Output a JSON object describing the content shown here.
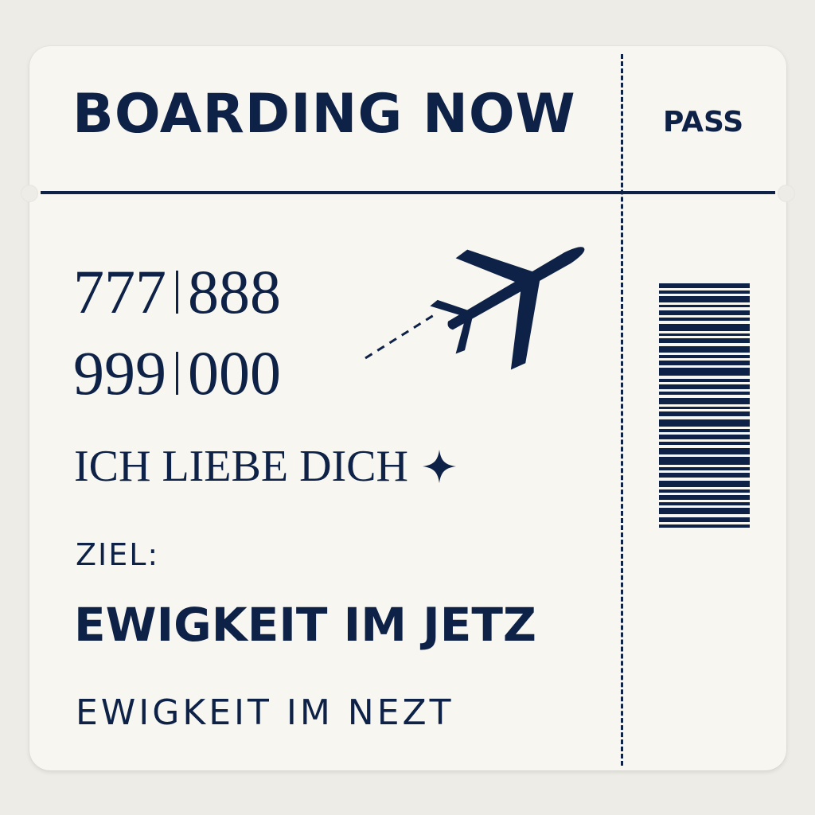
{
  "ticket": {
    "title": "BOARDING NOW",
    "stub_label": "PASS",
    "numbers": {
      "line1": [
        "777",
        "888"
      ],
      "line2": [
        "999",
        "000"
      ]
    },
    "phrase": "ICH LIEBE DICH",
    "destination_label": "ZIEL:",
    "destination": "EWIGKEIT IM JETZ",
    "sub_destination": "EWIGKEIT IM NEZT"
  },
  "icons": {
    "plane": "airplane-icon",
    "sparkle": "four-point-star-icon",
    "barcode": "barcode-icon"
  },
  "colors": {
    "ink": "#0e2247",
    "paper": "#f8f6f0",
    "background": "#eeece7"
  }
}
